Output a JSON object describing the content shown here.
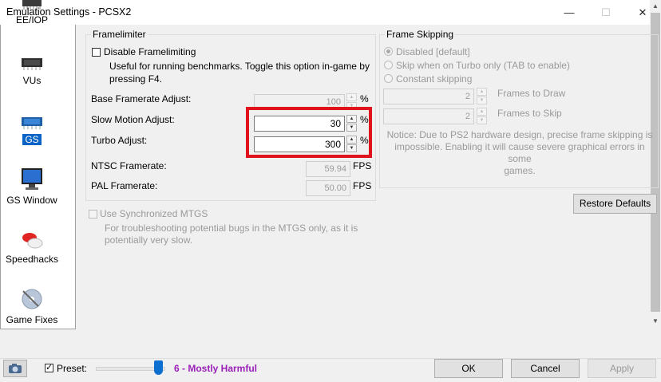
{
  "window": {
    "title": "Emulation Settings - PCSX2"
  },
  "sidebar": {
    "items": [
      {
        "label": "EE/IOP",
        "icon": "chip-icon"
      },
      {
        "label": "VUs",
        "icon": "processor-icon"
      },
      {
        "label": "GS",
        "icon": "gs-chip-icon",
        "selected": true
      },
      {
        "label": "GS Window",
        "icon": "monitor-icon"
      },
      {
        "label": "Speedhacks",
        "icon": "pills-icon"
      },
      {
        "label": "Game Fixes",
        "icon": "disc-icon"
      }
    ]
  },
  "framelimiter": {
    "title": "Framelimiter",
    "disable_label": "Disable Framelimiting",
    "disable_desc_1": "Useful for running benchmarks. Toggle this option in-game by",
    "disable_desc_2": "pressing F4.",
    "base_label": "Base Framerate Adjust:",
    "base_value": "100",
    "slow_label": "Slow Motion Adjust:",
    "slow_value": "30",
    "turbo_label": "Turbo Adjust:",
    "turbo_value": "300",
    "percent": "%",
    "ntsc_label": "NTSC Framerate:",
    "ntsc_value": "59.94",
    "pal_label": "PAL Framerate:",
    "pal_value": "50.00",
    "fps": "FPS"
  },
  "frame_skipping": {
    "title": "Frame Skipping",
    "options": [
      "Disabled [default]",
      "Skip when on Turbo only (TAB to enable)",
      "Constant skipping"
    ],
    "selected_index": 0,
    "draw_value": "2",
    "draw_label": "Frames to Draw",
    "skip_value": "2",
    "skip_label": "Frames to Skip",
    "notice_1": "Notice: Due to PS2 hardware design, precise frame skipping is",
    "notice_2": "impossible. Enabling it will cause severe graphical errors in some",
    "notice_3": "games."
  },
  "restore_defaults": "Restore Defaults",
  "mtgs": {
    "label": "Use Synchronized MTGS",
    "desc_1": "For troubleshooting potential bugs in the MTGS only, as it is",
    "desc_2": "potentially very slow."
  },
  "bottom": {
    "preset_label": "Preset:",
    "preset_checked": true,
    "preset_level": 6,
    "preset_value": "6 - Mostly Harmful",
    "ok": "OK",
    "cancel": "Cancel",
    "apply": "Apply"
  },
  "colors": {
    "highlight": "#e0131d",
    "preset_text": "#9a20b8",
    "selection": "#0b63c5"
  }
}
